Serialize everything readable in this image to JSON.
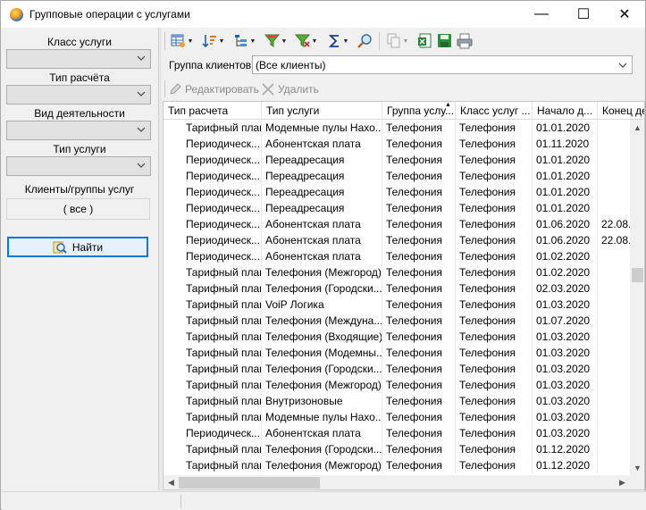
{
  "window": {
    "title": "Групповые операции с услугами",
    "minimize_glyph": "—",
    "maximize_glyph": "☐",
    "close_glyph": "✕"
  },
  "left_panel": {
    "service_class_label": "Класс услуги",
    "service_class_value": "",
    "calc_type_label": "Тип расчёта",
    "calc_type_value": "",
    "activity_label": "Вид деятельности",
    "activity_value": "",
    "service_type_label": "Тип услуги",
    "service_type_value": "",
    "clients_label": "Клиенты/группы услуг",
    "clients_value": "( все )",
    "find_button": "Найти"
  },
  "toolbar": {
    "icons": [
      "grid-settings-icon",
      "sort-icon",
      "tree-icon",
      "filter-icon",
      "filter-clear-icon",
      "sum-icon",
      "search-icon",
      "copy-icon",
      "export-excel-icon",
      "save-icon",
      "print-icon"
    ]
  },
  "client_group": {
    "label": "Группа клиентов",
    "value": "(Все клиенты)"
  },
  "actions": {
    "edit_label": "Редактировать",
    "delete_label": "Удалить"
  },
  "colors": {
    "accent": "#0078d7",
    "grid_border": "#c8c8c8",
    "disabled_text": "#8a8a8a"
  },
  "table": {
    "columns": [
      "Тип расчета",
      "Тип услуги",
      "Группа услу...",
      "Класс услуг ...",
      "Начало д...",
      "Конец де..."
    ],
    "sorted_column": 2,
    "rows": [
      [
        "Тарифный план",
        "Модемные пулы Нахо...",
        "Телефония",
        "Телефония",
        "01.01.2020",
        ""
      ],
      [
        "Периодическ...",
        "Абонентская плата",
        "Телефония",
        "Телефония",
        "01.11.2020",
        ""
      ],
      [
        "Периодическ...",
        "Переадресация",
        "Телефония",
        "Телефония",
        "01.01.2020",
        ""
      ],
      [
        "Периодическ...",
        "Переадресация",
        "Телефония",
        "Телефония",
        "01.01.2020",
        ""
      ],
      [
        "Периодическ...",
        "Переадресация",
        "Телефония",
        "Телефония",
        "01.01.2020",
        ""
      ],
      [
        "Периодическ...",
        "Переадресация",
        "Телефония",
        "Телефония",
        "01.01.2020",
        ""
      ],
      [
        "Периодическ...",
        "Абонентская плата",
        "Телефония",
        "Телефония",
        "01.06.2020",
        "22.08."
      ],
      [
        "Периодическ...",
        "Абонентская плата",
        "Телефония",
        "Телефония",
        "01.06.2020",
        "22.08."
      ],
      [
        "Периодическ...",
        "Абонентская плата",
        "Телефония",
        "Телефония",
        "01.02.2020",
        ""
      ],
      [
        "Тарифный план",
        "Телефония (Межгород)",
        "Телефония",
        "Телефония",
        "01.02.2020",
        ""
      ],
      [
        "Тарифный план",
        "Телефония (Городски...",
        "Телефония",
        "Телефония",
        "02.03.2020",
        ""
      ],
      [
        "Тарифный план",
        "VoiP Логика",
        "Телефония",
        "Телефония",
        "01.03.2020",
        ""
      ],
      [
        "Тарифный план",
        "Телефония (Междуна...",
        "Телефония",
        "Телефония",
        "01.07.2020",
        ""
      ],
      [
        "Тарифный план",
        "Телефония (Входящие)",
        "Телефония",
        "Телефония",
        "01.03.2020",
        ""
      ],
      [
        "Тарифный план",
        "Телефония (Модемны...",
        "Телефония",
        "Телефония",
        "01.03.2020",
        ""
      ],
      [
        "Тарифный план",
        "Телефония (Городски...",
        "Телефония",
        "Телефония",
        "01.03.2020",
        ""
      ],
      [
        "Тарифный план",
        "Телефония (Межгород)",
        "Телефония",
        "Телефония",
        "01.03.2020",
        ""
      ],
      [
        "Тарифный план",
        "Внутризоновые",
        "Телефония",
        "Телефония",
        "01.03.2020",
        ""
      ],
      [
        "Тарифный план",
        "Модемные пулы Нахо...",
        "Телефония",
        "Телефония",
        "01.03.2020",
        ""
      ],
      [
        "Периодическ...",
        "Абонентская плата",
        "Телефония",
        "Телефония",
        "01.03.2020",
        ""
      ],
      [
        "Тарифный план",
        "Телефония (Городски...",
        "Телефония",
        "Телефония",
        "01.12.2020",
        ""
      ],
      [
        "Тарифный план",
        "Телефония (Межгород)",
        "Телефония",
        "Телефония",
        "01.12.2020",
        ""
      ]
    ]
  }
}
